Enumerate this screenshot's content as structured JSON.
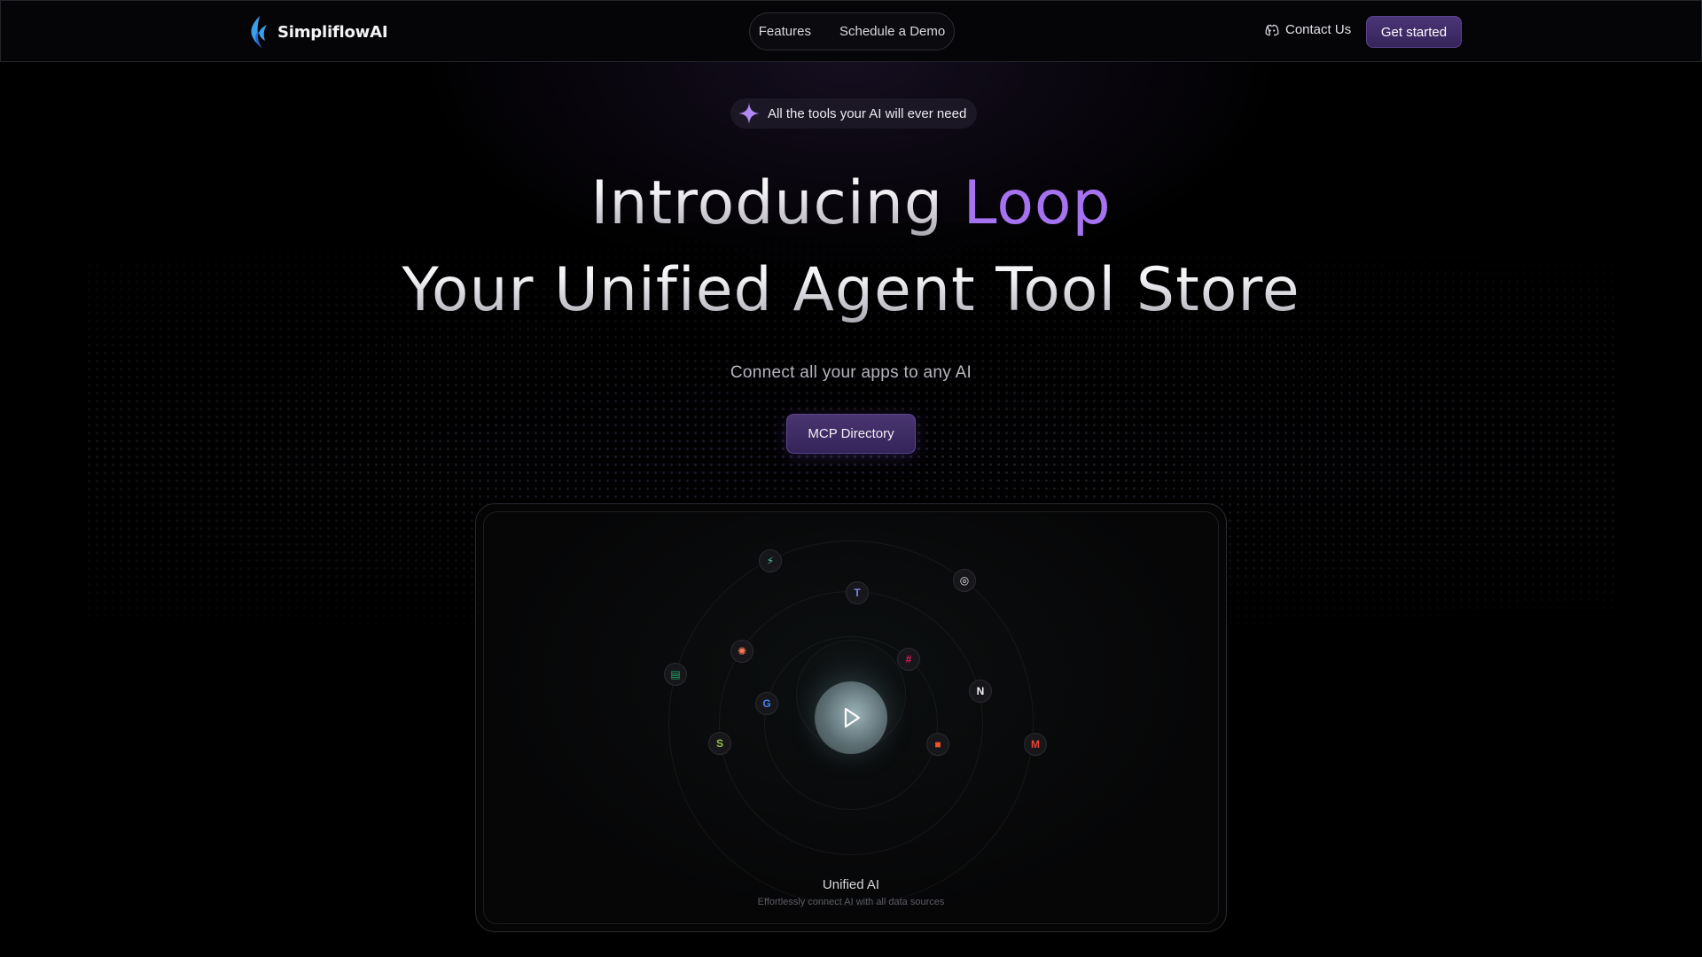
{
  "brand": {
    "name": "SimpliflowAI",
    "icon": "flame-logo"
  },
  "nav": {
    "links": [
      "Features",
      "Schedule a Demo"
    ],
    "contact_label": "Contact Us",
    "contact_icon": "discord-icon",
    "cta_label": "Get started"
  },
  "hero": {
    "badge_text": "All the tools your AI will ever need",
    "badge_icon": "sparkle-icon",
    "title_prefix": "Introducing ",
    "title_accent": "Loop",
    "title_line2": "Your Unified Agent Tool Store",
    "subtitle": "Connect all your apps to any AI",
    "cta_label": "MCP Directory"
  },
  "card": {
    "title": "Unified AI",
    "subtitle": "Effortlessly connect AI with all data sources",
    "apps": [
      {
        "name": "supabase-icon",
        "glyph": "⚡",
        "color": "#3ecf8e"
      },
      {
        "name": "teams-icon",
        "glyph": "T",
        "color": "#7b83eb"
      },
      {
        "name": "github-icon",
        "glyph": "◎",
        "color": "#e6e6e6"
      },
      {
        "name": "hubspot-icon",
        "glyph": "✺",
        "color": "#ff7a59"
      },
      {
        "name": "slack-icon",
        "glyph": "#",
        "color": "#e01e5a"
      },
      {
        "name": "sheets-icon",
        "glyph": "▤",
        "color": "#23a566"
      },
      {
        "name": "notion-icon",
        "glyph": "N",
        "color": "#f2f2f2"
      },
      {
        "name": "google-icon",
        "glyph": "G",
        "color": "#4285f4"
      },
      {
        "name": "shopify-icon",
        "glyph": "S",
        "color": "#95bf47"
      },
      {
        "name": "microsoft-icon",
        "glyph": "■",
        "color": "#f25022"
      },
      {
        "name": "gmail-icon",
        "glyph": "M",
        "color": "#ea4335"
      }
    ]
  },
  "colors": {
    "accent": "#a572f0",
    "cta": "#3f2d69",
    "background": "#000000"
  }
}
